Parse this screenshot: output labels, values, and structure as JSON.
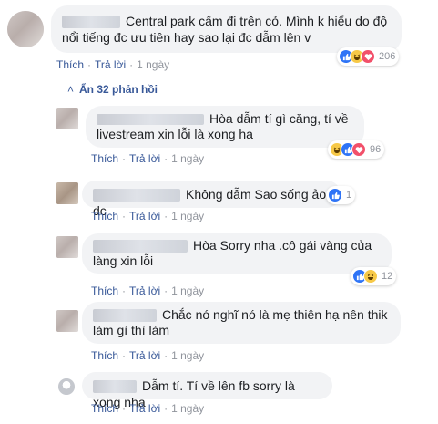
{
  "comment_main": {
    "text": "Central park cấm đi trên cỏ. Mình k hiểu do độ nổi tiếng đc ưu tiên hay sao lại đc dẫm lên v",
    "reaction_count": "206",
    "actions": {
      "like": "Thích",
      "reply": "Trả lời",
      "time": "1 ngày"
    }
  },
  "hidden_replies": {
    "label": "Ẩn 32 phản hồi"
  },
  "replies": [
    {
      "text": "Hòa dẫm tí gì căng, tí về livestream xin lỗi là xong ha",
      "reaction_count": "96",
      "actions": {
        "like": "Thích",
        "reply": "Trả lời",
        "time": "1 ngày"
      }
    },
    {
      "text": "Không dẫm Sao sống ảo dc",
      "reaction_count": "1",
      "actions": {
        "like": "Thích",
        "reply": "Trả lời",
        "time": "1 ngày"
      }
    },
    {
      "text": "Hòa Sorry nha .cô gái vàng của làng xin lỗi",
      "reaction_count": "12",
      "actions": {
        "like": "Thích",
        "reply": "Trả lời",
        "time": "1 ngày"
      }
    },
    {
      "text": "Chắc nó nghĩ nó là mẹ thiên hạ nên thik làm gì thì làm",
      "actions": {
        "like": "Thích",
        "reply": "Trả lời",
        "time": "1 ngày"
      }
    },
    {
      "text": "Dẫm tí. Tí về lên fb sorry là xong nha",
      "actions": {
        "like": "Thích",
        "reply": "Trả lời",
        "time": "1 ngày"
      }
    }
  ],
  "colors": {
    "link": "#385898",
    "bubble": "#f2f3f5",
    "like": "#2f74f6",
    "haha": "#f7c948",
    "love": "#f2506a"
  }
}
